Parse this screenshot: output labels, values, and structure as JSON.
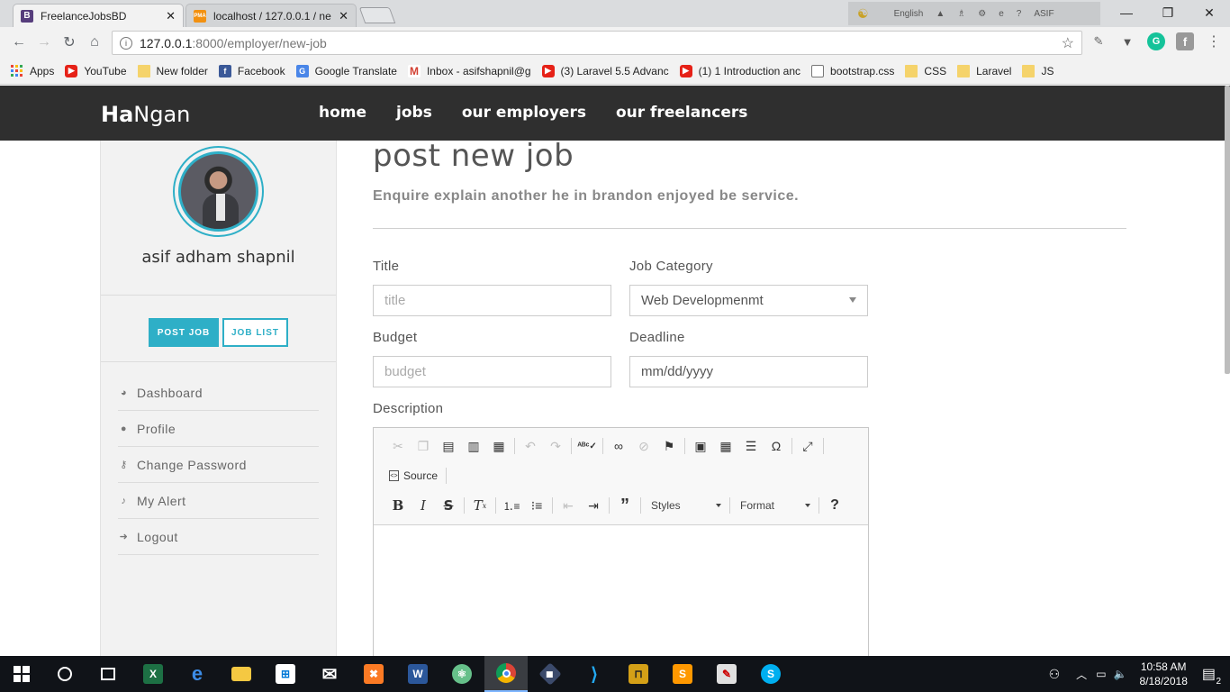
{
  "browser": {
    "tabs": [
      {
        "label": "FreelanceJobsBD",
        "favicon": "B",
        "favicon_color": "#563d7c",
        "active": true
      },
      {
        "label": "localhost / 127.0.0.1 / ne",
        "favicon": "PMA",
        "favicon_color": "#f29111",
        "active": false
      }
    ],
    "close_glyph": "✕",
    "language": "English",
    "user_badge": "ASIF",
    "url_host": "127.0.0.1",
    "url_rest": ":8000/employer/new-job",
    "bookmarks": [
      {
        "label": "Apps",
        "icon": "apps-icon"
      },
      {
        "label": "YouTube",
        "icon": "youtube-icon"
      },
      {
        "label": "New folder",
        "icon": "folder-icon"
      },
      {
        "label": "Facebook",
        "icon": "facebook-icon"
      },
      {
        "label": "Google Translate",
        "icon": "google-translate-icon"
      },
      {
        "label": "Inbox - asifshapnil@g",
        "icon": "gmail-icon"
      },
      {
        "label": "(3) Laravel 5.5 Advanc",
        "icon": "youtube-icon"
      },
      {
        "label": "(1) 1 Introduction anc",
        "icon": "youtube-icon"
      },
      {
        "label": "bootstrap.css",
        "icon": "document-icon"
      },
      {
        "label": "CSS",
        "icon": "folder-icon"
      },
      {
        "label": "Laravel",
        "icon": "folder-icon"
      },
      {
        "label": "JS",
        "icon": "folder-icon"
      }
    ]
  },
  "site": {
    "brand_bold": "Ha",
    "brand_rest": "Ngan",
    "nav": [
      "home",
      "jobs",
      "our employers",
      "our freelancers"
    ]
  },
  "sidebar": {
    "username": "asif adham shapnil",
    "post_job_label": "POST JOB",
    "job_list_label": "JOB LIST",
    "menu": [
      {
        "label": "Dashboard",
        "icon": "dashboard-icon",
        "glyph": "◕"
      },
      {
        "label": "Profile",
        "icon": "user-icon",
        "glyph": "●"
      },
      {
        "label": "Change Password",
        "icon": "key-icon",
        "glyph": "⚷"
      },
      {
        "label": "My Alert",
        "icon": "bell-icon",
        "glyph": "♪"
      },
      {
        "label": "Logout",
        "icon": "logout-icon",
        "glyph": "➜"
      }
    ]
  },
  "main": {
    "title": "post new job",
    "subtitle": "Enquire explain another he in brandon enjoyed be service.",
    "fields": {
      "title_label": "Title",
      "title_placeholder": "title",
      "category_label": "Job Category",
      "category_value": "Web Developmenmt",
      "budget_label": "Budget",
      "budget_placeholder": "budget",
      "deadline_label": "Deadline",
      "deadline_placeholder": "mm/dd/yyyy",
      "description_label": "Description"
    },
    "editor": {
      "source_label": "Source",
      "styles_label": "Styles",
      "format_label": "Format",
      "bold_glyph": "B",
      "italic_glyph": "I",
      "strike_glyph": "S",
      "help_glyph": "?"
    }
  },
  "taskbar": {
    "time": "10:58 AM",
    "date": "8/18/2018",
    "notification_count": "2"
  },
  "colors": {
    "accent": "#2eafc7",
    "navbar": "#2f2f2f",
    "sidebar_bg": "#f2f2f2"
  }
}
